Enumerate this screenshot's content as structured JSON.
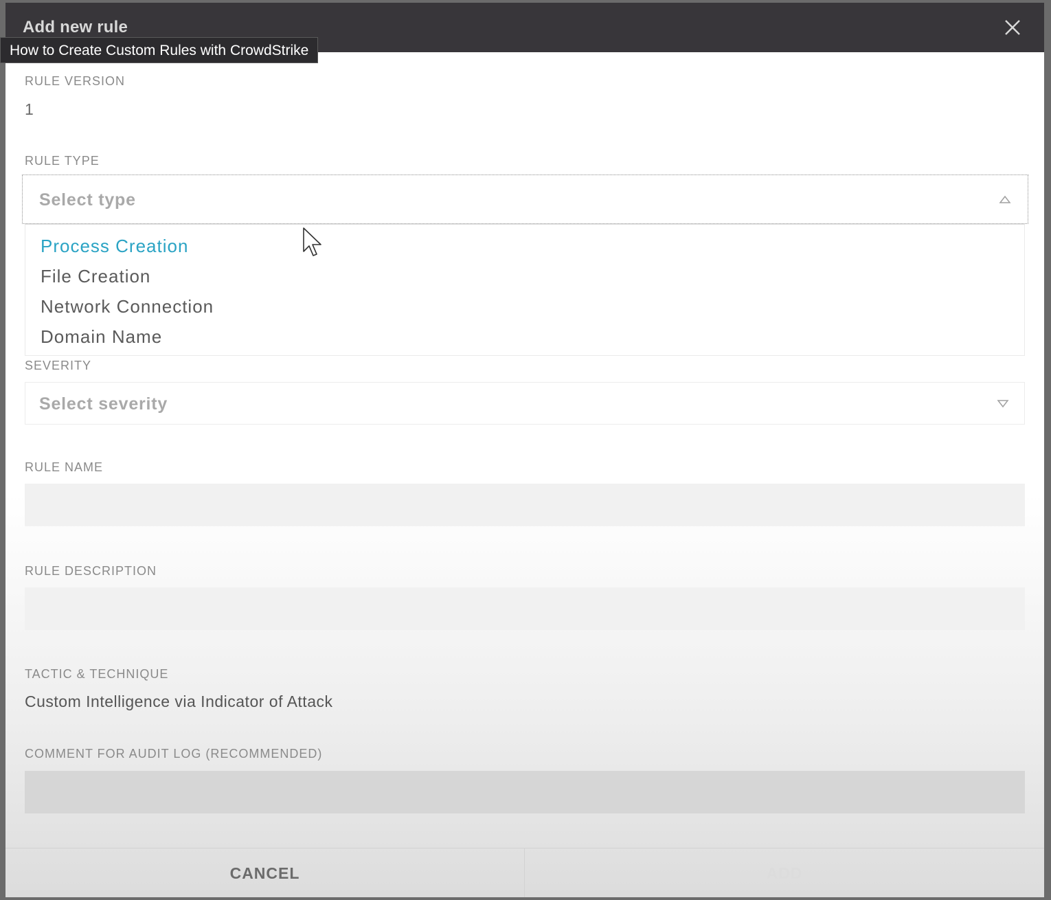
{
  "modal": {
    "title": "Add new rule",
    "tooltip": "How to Create Custom Rules with CrowdStrike",
    "close_icon": "close-icon"
  },
  "rule_version": {
    "label": "RULE VERSION",
    "value": "1"
  },
  "rule_type": {
    "label": "RULE TYPE",
    "placeholder": "Select type",
    "options": [
      "Process Creation",
      "File Creation",
      "Network Connection",
      "Domain Name"
    ],
    "highlighted": "Process Creation"
  },
  "severity": {
    "label": "SEVERITY",
    "placeholder": "Select severity"
  },
  "rule_name": {
    "label": "RULE NAME",
    "value": ""
  },
  "rule_description": {
    "label": "RULE DESCRIPTION",
    "value": ""
  },
  "tactic": {
    "label": "TACTIC & TECHNIQUE",
    "value": "Custom Intelligence via Indicator of Attack"
  },
  "comment": {
    "label": "COMMENT FOR AUDIT LOG (RECOMMENDED)",
    "value": ""
  },
  "footer": {
    "cancel_label": "CANCEL",
    "add_label": "ADD"
  },
  "colors": {
    "header_bg": "#38363a",
    "accent": "#2aa3c4"
  }
}
